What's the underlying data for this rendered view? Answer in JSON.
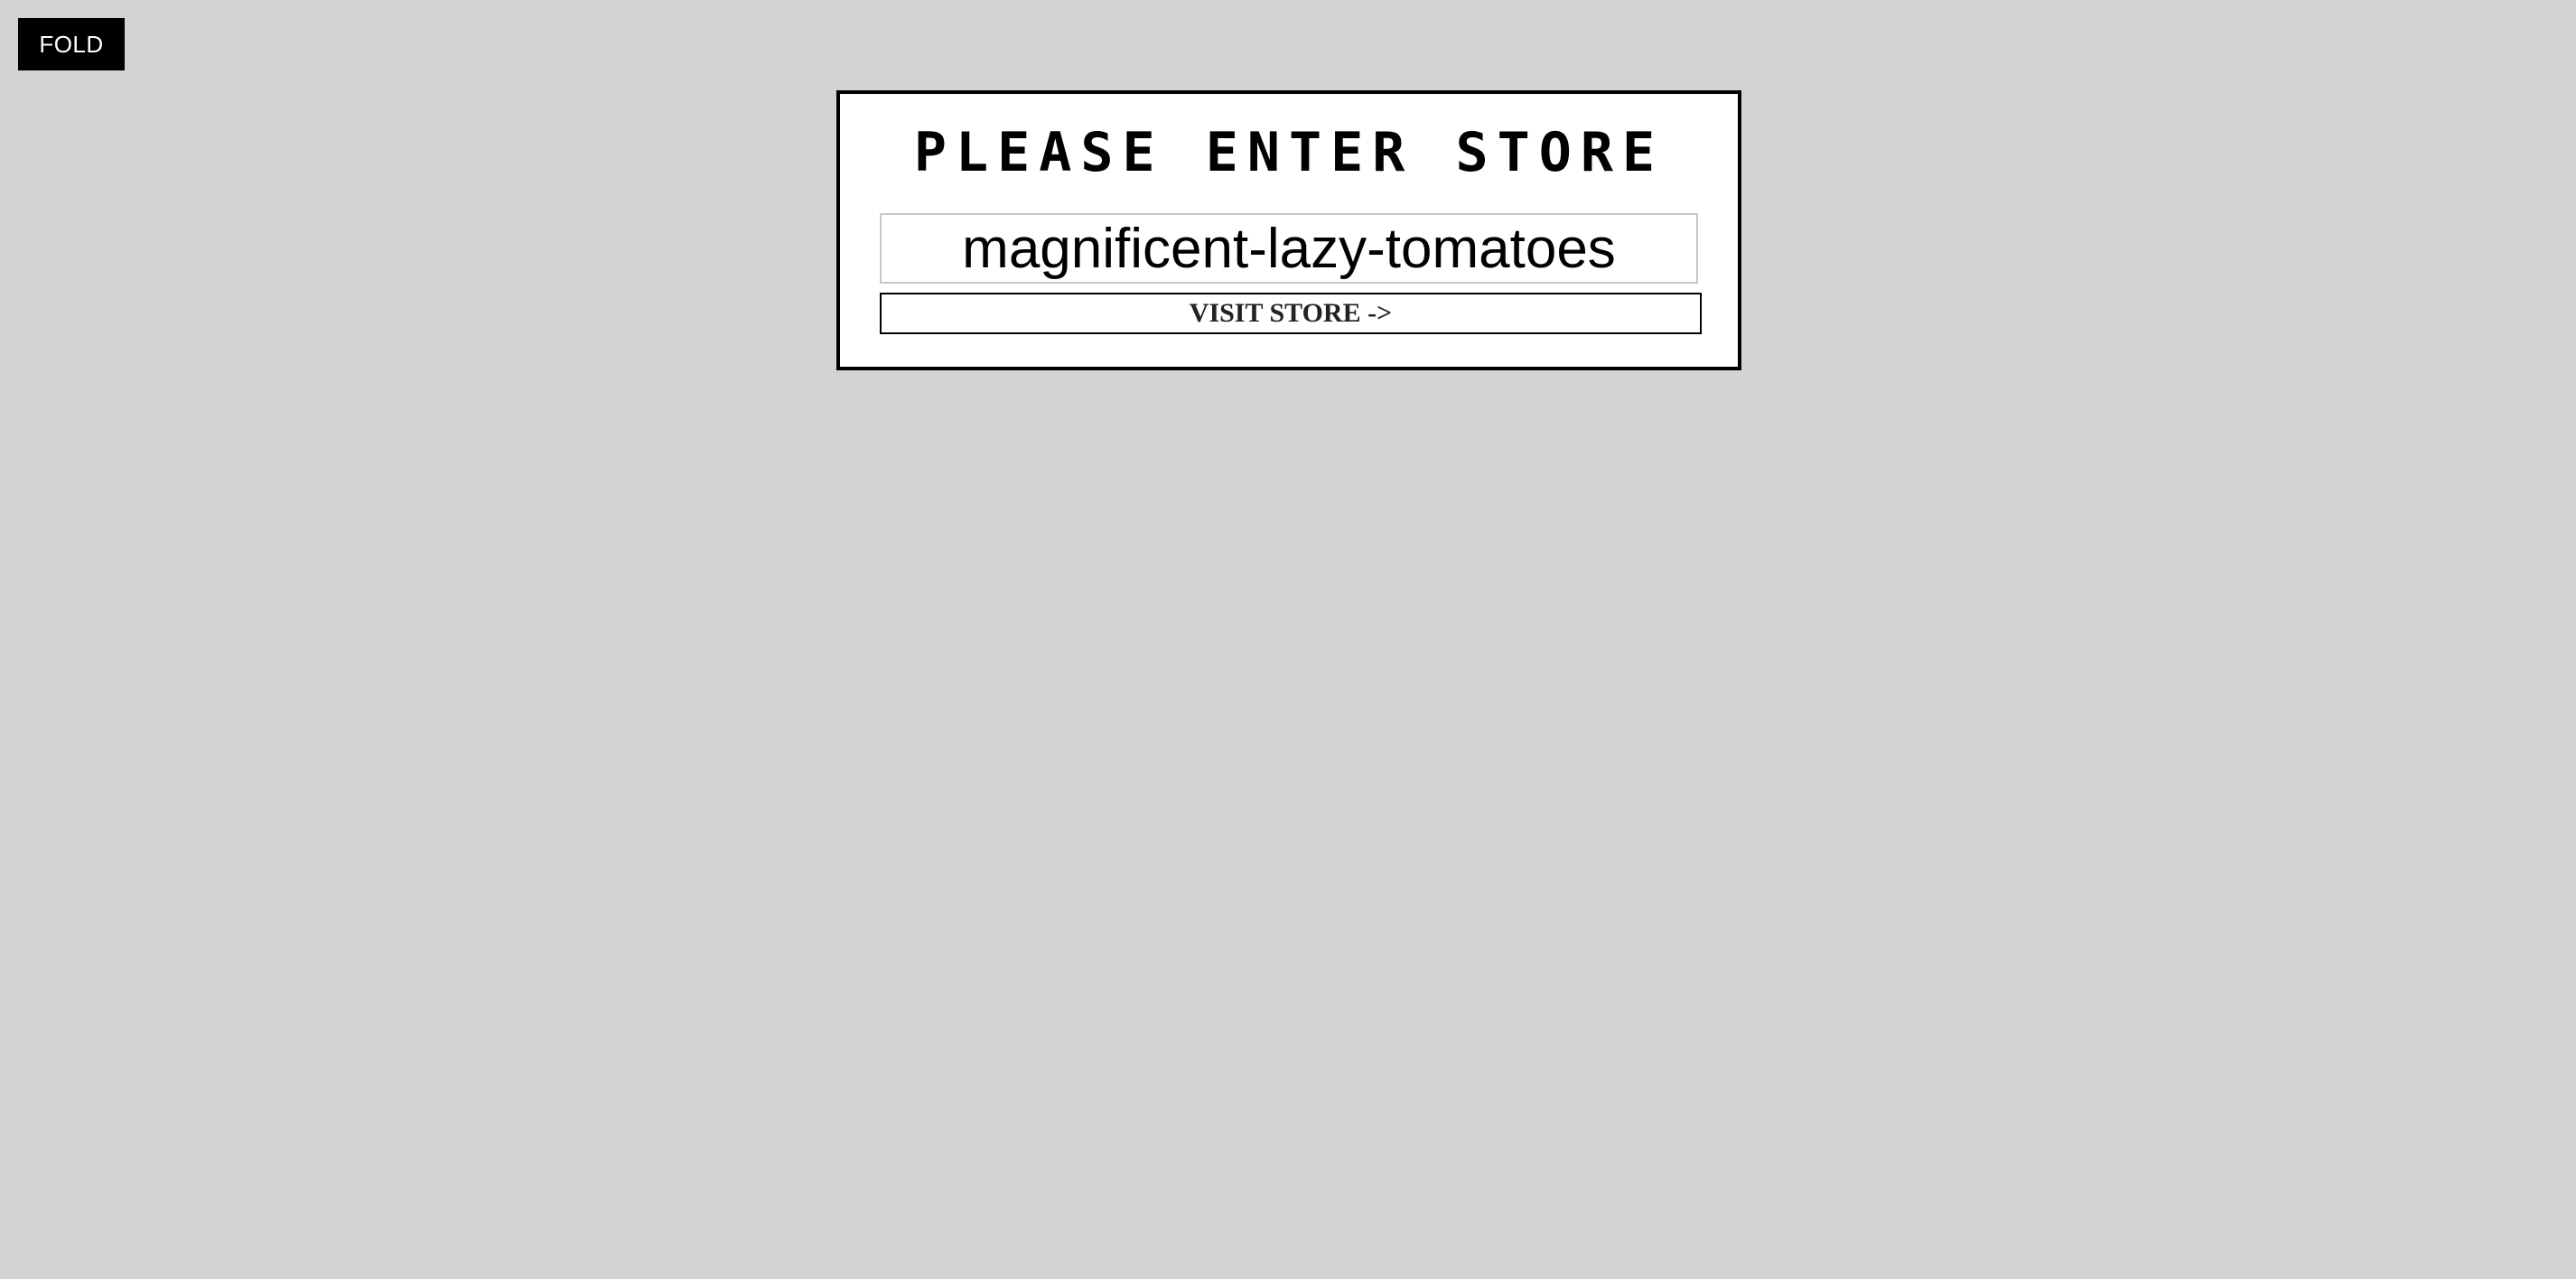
{
  "fold_button": {
    "label": "FOLD"
  },
  "store_card": {
    "title": "PLEASE ENTER STORE",
    "store_input": {
      "value": "magnificent-lazy-tomatoes",
      "placeholder": ""
    },
    "visit_button": {
      "label": "VISIT STORE ->"
    }
  },
  "colors": {
    "page_background": "#d3d3d3",
    "fold_background": "#000000",
    "card_background": "#ffffff",
    "card_border": "#000000"
  }
}
